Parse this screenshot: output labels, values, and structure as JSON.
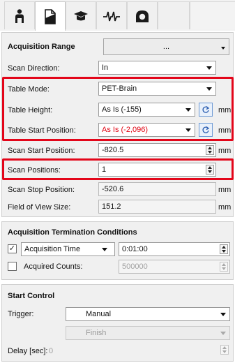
{
  "tabs": [
    {
      "icon": "person-icon"
    },
    {
      "icon": "document-icon"
    },
    {
      "icon": "graduation-cap-icon"
    },
    {
      "icon": "waveform-icon"
    },
    {
      "icon": "scanner-gantry-icon"
    }
  ],
  "acquisition_range": {
    "title": "Acquisition Range",
    "button_label": "...",
    "scan_direction": {
      "label": "Scan Direction:",
      "value": "In"
    },
    "table_mode": {
      "label": "Table Mode:",
      "value": "PET-Brain"
    },
    "table_height": {
      "label": "Table Height:",
      "value": "As Is (-155)",
      "unit": "mm"
    },
    "table_start_position": {
      "label": "Table Start Position:",
      "value": "As Is (-2,096)",
      "unit": "mm",
      "value_color": "#e0000f"
    },
    "scan_start_position": {
      "label": "Scan Start Position:",
      "value": "-820.5",
      "unit": "mm"
    },
    "scan_positions": {
      "label": "Scan Positions:",
      "value": "1"
    },
    "scan_stop_position": {
      "label": "Scan Stop Position:",
      "value": "-520.6",
      "unit": "mm"
    },
    "field_of_view_size": {
      "label": "Field of View Size:",
      "value": "151.2",
      "unit": "mm"
    }
  },
  "termination": {
    "title": "Acquisition Termination Conditions",
    "acquisition_time": {
      "label": "Acquisition Time",
      "checked": true,
      "check_glyph": "✓",
      "value": "0:01:00"
    },
    "acquired_counts": {
      "label": "Acquired Counts:",
      "checked": false,
      "value": "500000"
    }
  },
  "start_control": {
    "title": "Start Control",
    "trigger": {
      "label": "Trigger:",
      "value": "Manual"
    },
    "finish": {
      "value": "Finish"
    },
    "delay": {
      "label": "Delay [sec]:",
      "value": "0"
    }
  },
  "highlight_color": "#e3061a"
}
